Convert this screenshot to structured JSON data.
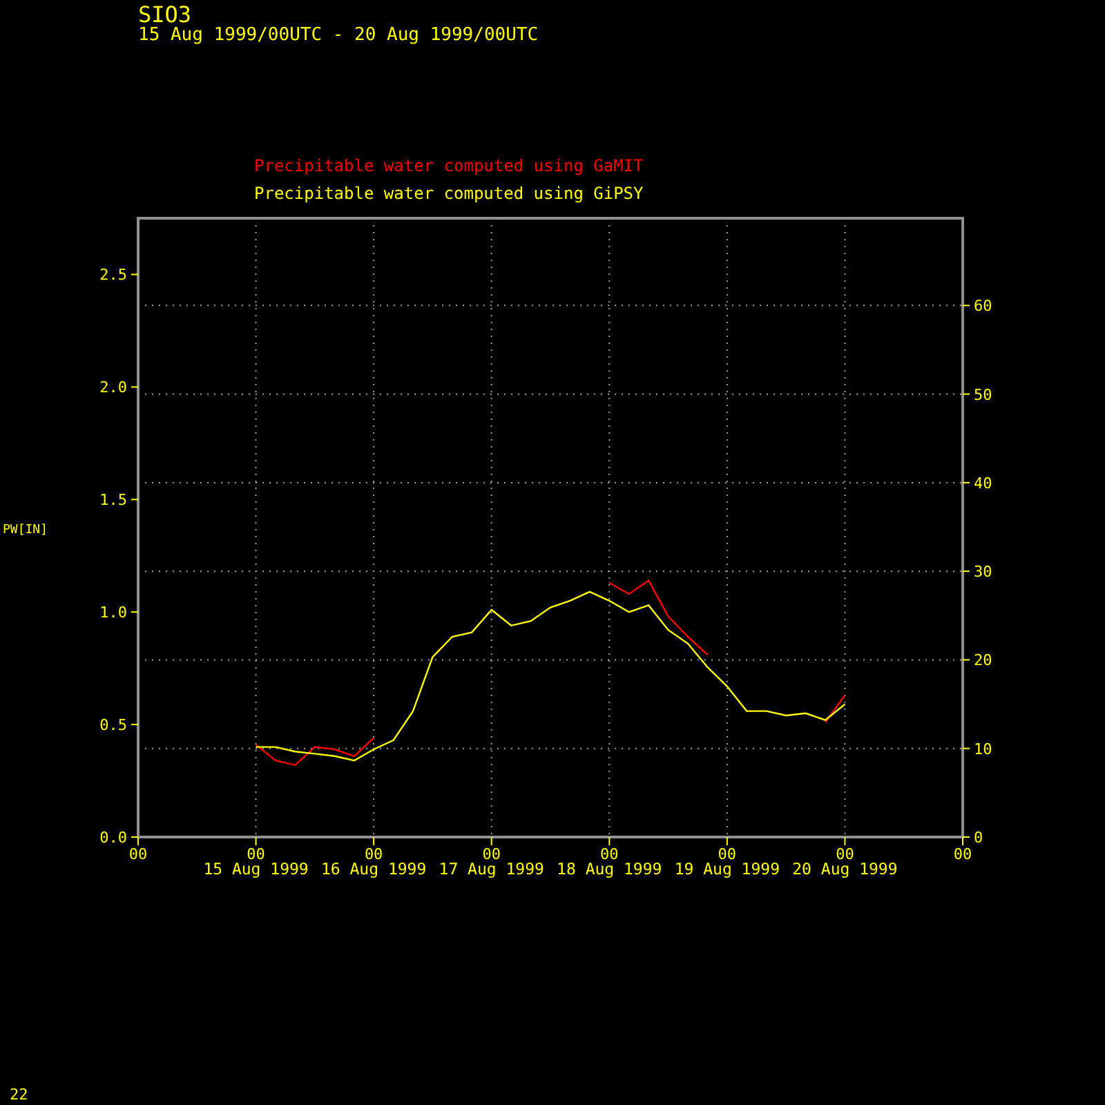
{
  "header": {
    "station": "SIO3",
    "period": "15 Aug 1999/00UTC - 20 Aug 1999/00UTC"
  },
  "plot": {
    "ylabel_left": "PW[IN]",
    "hour_labels": [
      "00",
      "00",
      "00",
      "00",
      "00",
      "00",
      "00",
      "00"
    ],
    "chart_data": {
      "type": "line",
      "categories": [
        null,
        null,
        null,
        null,
        null,
        null,
        "15 Aug 1999",
        null,
        null,
        null,
        null,
        null,
        "16 Aug 1999",
        null,
        null,
        null,
        null,
        null,
        "17 Aug 1999",
        null,
        null,
        null,
        null,
        null,
        "18 Aug 1999",
        null,
        null,
        null,
        null,
        null,
        "19 Aug 1999",
        null,
        null,
        null,
        null,
        null,
        "20 Aug 1999",
        null,
        null,
        null,
        null,
        null,
        null
      ],
      "series": [
        {
          "name": "Precipitable water computed using GaMIT",
          "color": "#ff0000",
          "values": [
            null,
            null,
            null,
            null,
            null,
            null,
            0.41,
            0.34,
            0.32,
            0.4,
            0.39,
            0.36,
            0.44,
            null,
            null,
            null,
            null,
            null,
            null,
            null,
            null,
            null,
            null,
            null,
            1.13,
            1.08,
            1.14,
            0.98,
            0.89,
            0.81,
            null,
            null,
            null,
            null,
            null,
            0.51,
            0.63,
            null,
            null,
            null,
            null,
            null,
            null
          ]
        },
        {
          "name": "Precipitable water computed using GiPSY",
          "color": "#ffff00",
          "values": [
            null,
            null,
            null,
            null,
            null,
            null,
            0.4,
            0.4,
            0.38,
            0.37,
            0.36,
            0.34,
            0.39,
            0.43,
            0.56,
            0.8,
            0.89,
            0.91,
            1.01,
            0.94,
            0.96,
            1.02,
            1.05,
            1.09,
            1.05,
            1.0,
            1.03,
            0.92,
            0.86,
            0.755,
            0.67,
            0.56,
            0.56,
            0.54,
            0.55,
            0.52,
            0.59,
            null,
            null,
            null,
            null,
            null,
            null
          ]
        }
      ],
      "grid": true,
      "ylim": [
        0,
        2.75
      ],
      "y2lim": [
        0,
        69.85
      ],
      "yticks": [
        {
          "value": 0,
          "label": "0.0"
        },
        {
          "value": 0.5,
          "label": "0.5"
        },
        {
          "value": 1,
          "label": "1.0"
        },
        {
          "value": 1.5,
          "label": "1.5"
        },
        {
          "value": 2,
          "label": "2.0"
        },
        {
          "value": 2.5,
          "label": "2.5"
        }
      ],
      "y2ticks": [
        0,
        10,
        20,
        30,
        40,
        50,
        60
      ]
    }
  },
  "footer": {
    "page": "22"
  }
}
